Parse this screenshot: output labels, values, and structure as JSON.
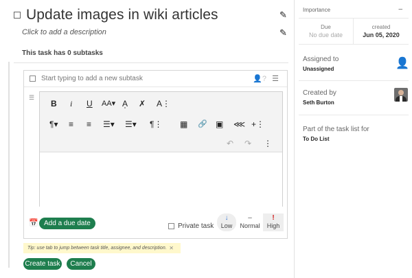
{
  "task": {
    "title": "Update images in wiki articles",
    "description_placeholder": "Click to add a description",
    "subtasks_summary": "This task has 0 subtasks"
  },
  "subtask": {
    "placeholder": "Start typing to add a new subtask"
  },
  "toolbar": {
    "row1": [
      "B",
      "i",
      "U",
      "AA▾",
      "A̩",
      "✗",
      "A⋮"
    ],
    "row2": [
      "¶▾",
      "≡",
      "≡",
      "☰▾",
      "☰▾",
      "¶⋮",
      "▦",
      "🔗",
      "▣",
      "⋘",
      "+⋮"
    ],
    "row3": [
      "↶",
      "↷",
      "⋮"
    ]
  },
  "footer": {
    "add_due_date": "Add a due date",
    "private_task": "Private task",
    "priority": [
      {
        "symbol": "↓",
        "label": "Low",
        "selected": false
      },
      {
        "symbol": "–",
        "label": "Normal",
        "selected": true
      },
      {
        "symbol": "!",
        "label": "High",
        "selected": false
      }
    ],
    "tip": "Tip: use tab to jump between task title, assignee, and description.",
    "create": "Create task",
    "cancel": "Cancel"
  },
  "sidebar": {
    "importance_label": "Importance",
    "collapse_symbol": "–",
    "due_label": "Due",
    "due_value": "No due date",
    "created_label": "created",
    "created_value": "Jun 05, 2020",
    "assigned_label": "Assigned to",
    "assigned_value": "Unassigned",
    "created_by_label": "Created by",
    "created_by_value": "Seth Burton",
    "tasklist_label": "Part of the task list for",
    "tasklist_value": "To Do List"
  },
  "colors": {
    "primary_button": "#1e7e4e",
    "high_priority": "#d01b1b",
    "low_priority": "#3a7bd5",
    "tip_background": "#fff8cc"
  }
}
